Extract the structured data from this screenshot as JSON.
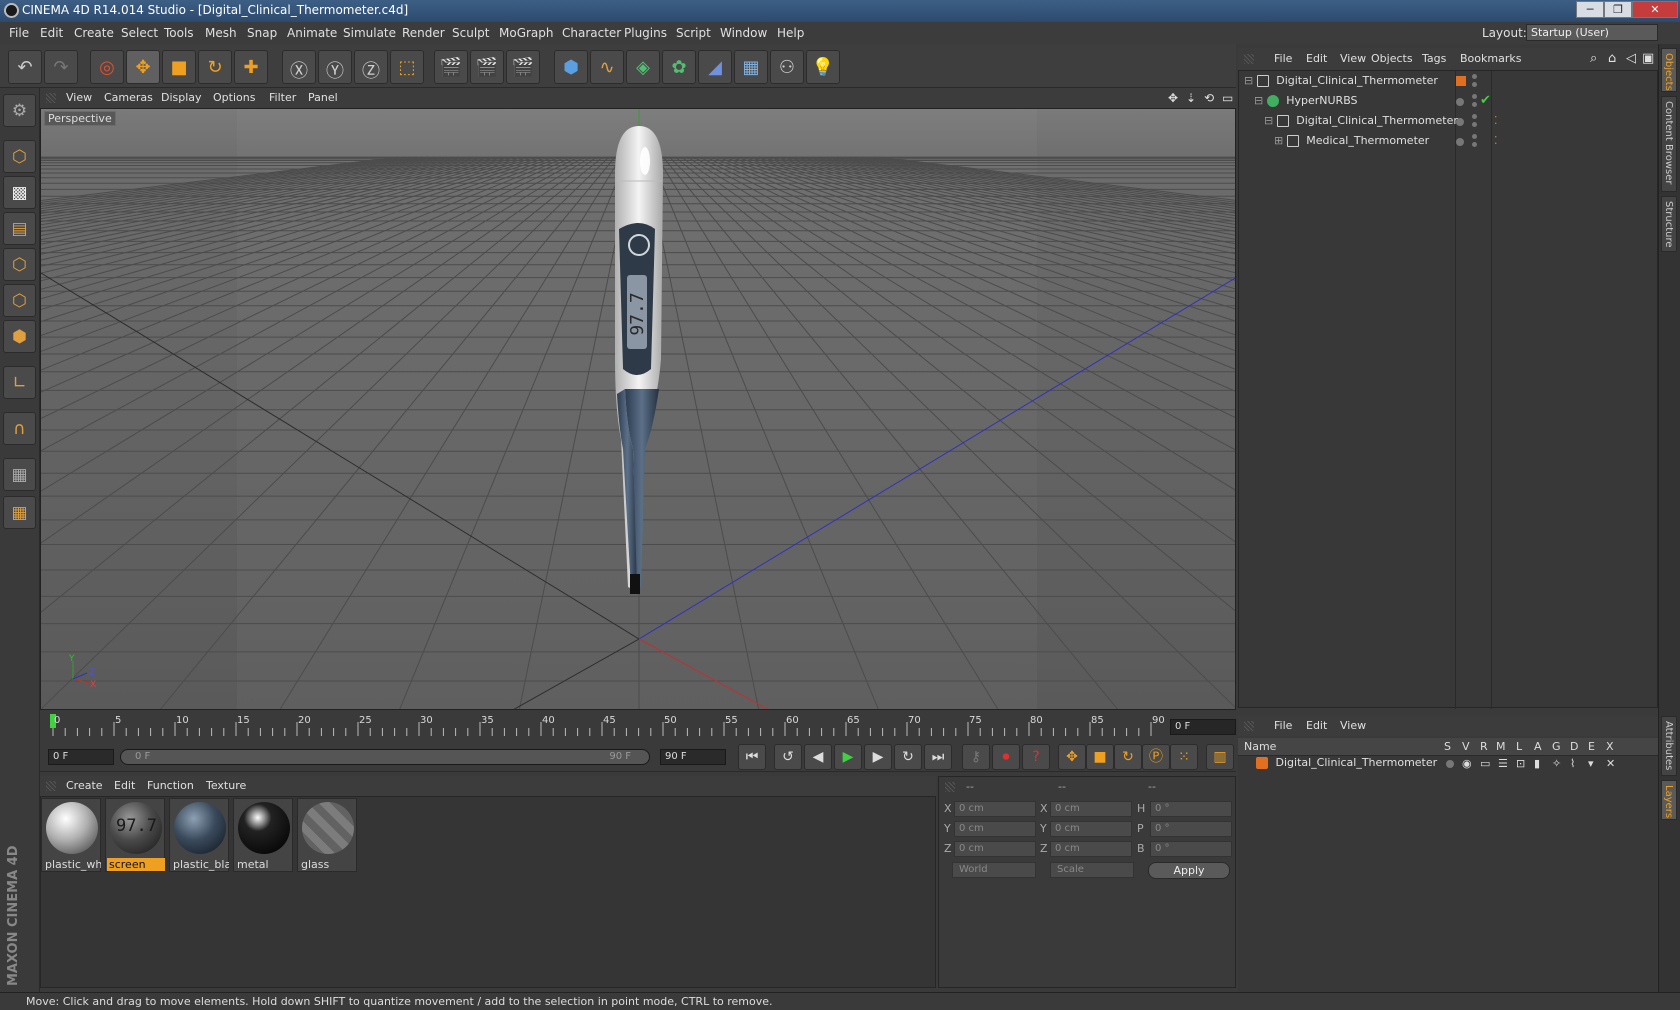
{
  "window": {
    "title": "CINEMA 4D R14.014 Studio - [Digital_Clinical_Thermometer.c4d]",
    "minimize": "─",
    "restore": "❐",
    "close": "✕"
  },
  "menubar": {
    "items": [
      "File",
      "Edit",
      "Create",
      "Select",
      "Tools",
      "Mesh",
      "Snap",
      "Animate",
      "Simulate",
      "Render",
      "Sculpt",
      "MoGraph",
      "Character",
      "Plugins",
      "Script",
      "Window",
      "Help"
    ],
    "layout_label": "Layout:",
    "layout_value": "Startup (User)"
  },
  "viewport": {
    "menu": [
      "View",
      "Cameras",
      "Display",
      "Options",
      "Filter",
      "Panel"
    ],
    "label": "Perspective",
    "axis_x": "X",
    "axis_y": "Y",
    "axis_z": "Z",
    "display_reading": "97.7"
  },
  "timeline": {
    "ticks": [
      "0",
      "5",
      "10",
      "15",
      "20",
      "25",
      "30",
      "35",
      "40",
      "45",
      "50",
      "55",
      "60",
      "65",
      "70",
      "75",
      "80",
      "85",
      "90"
    ],
    "current_frame": "0 F",
    "start_field": "0 F",
    "range_start": "0 F",
    "range_end": "90 F",
    "end_field": "90 F"
  },
  "materials": {
    "menu": [
      "Create",
      "Edit",
      "Function",
      "Texture"
    ],
    "items": [
      {
        "name": "plastic_whi",
        "color": "#c8c8c8"
      },
      {
        "name": "screen",
        "color": "#3c3c3c",
        "selected": true,
        "display_text": "97.7"
      },
      {
        "name": "plastic_bla",
        "color": "#3a4a5c"
      },
      {
        "name": "metal",
        "color": "#111111"
      },
      {
        "name": "glass",
        "color": "#7a7a7a"
      }
    ]
  },
  "coordinates": {
    "header": [
      "--",
      "--",
      "--"
    ],
    "rows": [
      {
        "l1": "X",
        "v1": "0 cm",
        "l2": "X",
        "v2": "0 cm",
        "l3": "H",
        "v3": "0 °"
      },
      {
        "l1": "Y",
        "v1": "0 cm",
        "l2": "Y",
        "v2": "0 cm",
        "l3": "P",
        "v3": "0 °"
      },
      {
        "l1": "Z",
        "v1": "0 cm",
        "l2": "Z",
        "v2": "0 cm",
        "l3": "B",
        "v3": "0 °"
      }
    ],
    "world": "World",
    "scale": "Scale",
    "apply": "Apply"
  },
  "object_manager": {
    "menu": [
      "File",
      "Edit",
      "View",
      "Objects",
      "Tags",
      "Bookmarks"
    ],
    "objects": [
      {
        "name": "Digital_Clinical_Thermometer",
        "indent": 0,
        "type": "null"
      },
      {
        "name": "HyperNURBS",
        "indent": 1,
        "type": "nurbs"
      },
      {
        "name": "Digital_Clinical_Thermometer",
        "indent": 2,
        "type": "null"
      },
      {
        "name": "Medical_Thermometer",
        "indent": 3,
        "type": "null"
      }
    ]
  },
  "layer_manager": {
    "menu": [
      "File",
      "Edit",
      "View"
    ],
    "columns": [
      "Name",
      "S",
      "V",
      "R",
      "M",
      "L",
      "A",
      "G",
      "D",
      "E",
      "X"
    ],
    "layers": [
      {
        "name": "Digital_Clinical_Thermometer",
        "color": "#e07020"
      }
    ]
  },
  "right_tabs": [
    "Objects",
    "Content Browser",
    "Structure",
    "Attributes",
    "Layers"
  ],
  "status": "Move: Click and drag to move elements. Hold down SHIFT to quantize movement / add to the selection in point mode, CTRL to remove.",
  "colors": {
    "accent": "#f0a020",
    "x_axis": "#c03030",
    "y_axis": "#30a030",
    "z_axis": "#3030c0"
  }
}
